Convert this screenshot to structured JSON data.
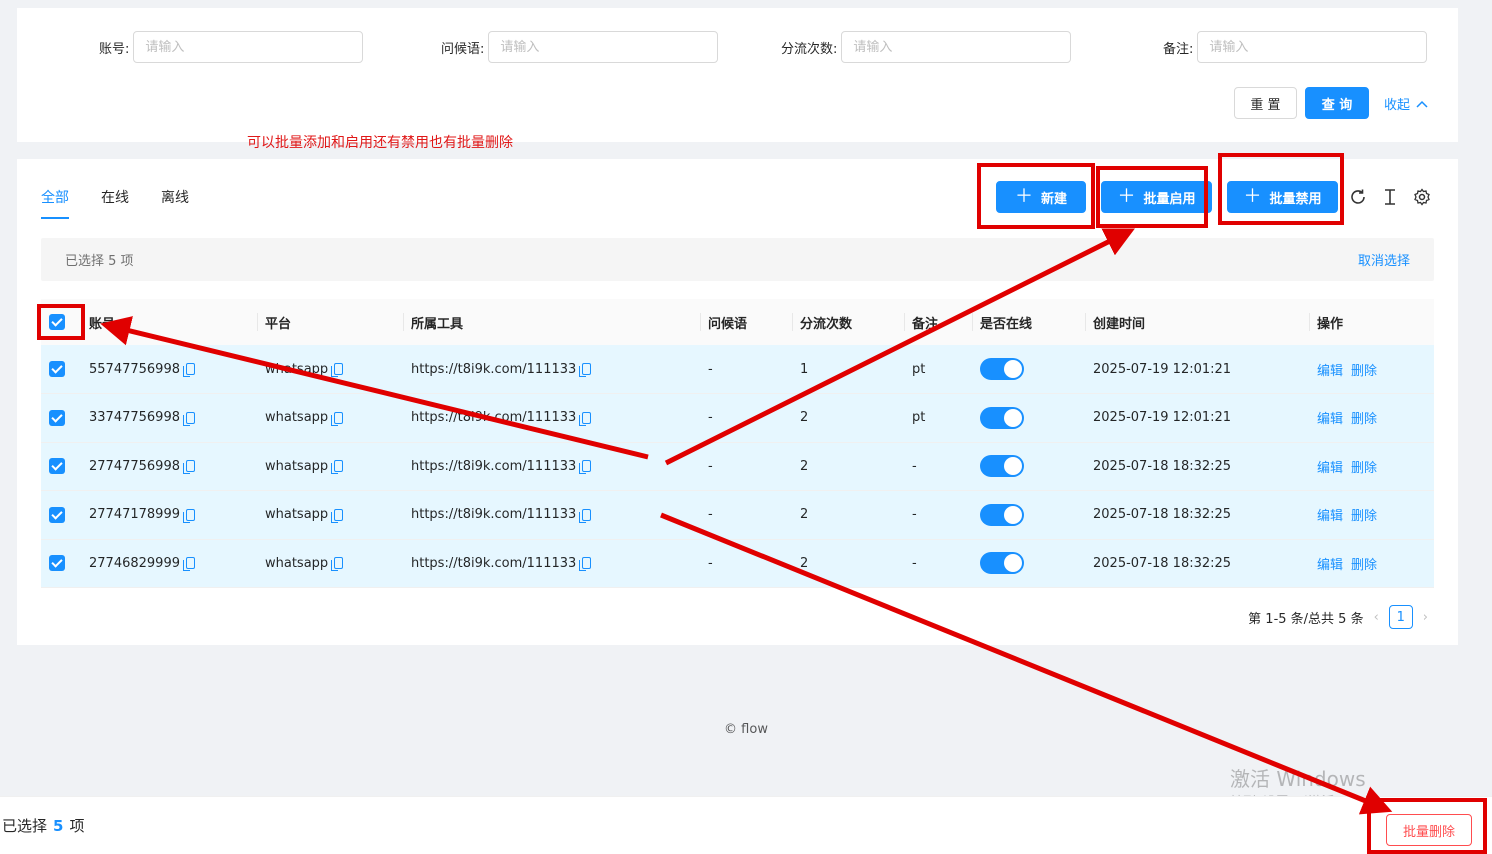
{
  "search": {
    "fields": [
      {
        "label": "账号:",
        "placeholder": "请输入"
      },
      {
        "label": "问候语:",
        "placeholder": "请输入"
      },
      {
        "label": "分流次数:",
        "placeholder": "请输入"
      },
      {
        "label": "备注:",
        "placeholder": "请输入"
      }
    ],
    "reset_label": "重 置",
    "query_label": "查 询",
    "collapse_label": "收起"
  },
  "annotation": "可以批量添加和启用还有禁用也有批量删除",
  "tabs": [
    "全部",
    "在线",
    "离线"
  ],
  "toolbar": {
    "new_label": "新建",
    "batch_enable_label": "批量启用",
    "batch_disable_label": "批量禁用"
  },
  "alert": {
    "selected_text": "已选择  5  项",
    "cancel_label": "取消选择"
  },
  "table": {
    "columns": [
      "账号",
      "平台",
      "所属工具",
      "问候语",
      "分流次数",
      "备注",
      "是否在线",
      "创建时间",
      "操作"
    ],
    "rows": [
      {
        "account": "55747756998",
        "platform": "whatsapp",
        "tool": "https://t8i9k.com/111133",
        "greeting": "-",
        "count": "1",
        "remark": "pt",
        "created": "2025-07-19 12:01:21"
      },
      {
        "account": "33747756998",
        "platform": "whatsapp",
        "tool": "https://t8i9k.com/111133",
        "greeting": "-",
        "count": "2",
        "remark": "pt",
        "created": "2025-07-19 12:01:21"
      },
      {
        "account": "27747756998",
        "platform": "whatsapp",
        "tool": "https://t8i9k.com/111133",
        "greeting": "-",
        "count": "2",
        "remark": "-",
        "created": "2025-07-18 18:32:25"
      },
      {
        "account": "27747178999",
        "platform": "whatsapp",
        "tool": "https://t8i9k.com/111133",
        "greeting": "-",
        "count": "2",
        "remark": "-",
        "created": "2025-07-18 18:32:25"
      },
      {
        "account": "27746829999",
        "platform": "whatsapp",
        "tool": "https://t8i9k.com/111133",
        "greeting": "-",
        "count": "2",
        "remark": "-",
        "created": "2025-07-18 18:32:25"
      }
    ],
    "edit_label": "编辑",
    "delete_label": "删除"
  },
  "pagination": {
    "summary": "第 1-5 条/总共 5 条",
    "current_page": "1"
  },
  "footer": {
    "brand": "flow"
  },
  "watermark": {
    "line1": "激活 Windows",
    "line2": "转到“设置”以激活 Windows。"
  },
  "footer_bar": {
    "prefix": "已选择",
    "count": "5",
    "suffix": "项",
    "batch_delete_label": "批量删除"
  },
  "colors": {
    "primary": "#1890ff",
    "danger": "#ff4d4f",
    "annotation_red": "#e00000"
  }
}
